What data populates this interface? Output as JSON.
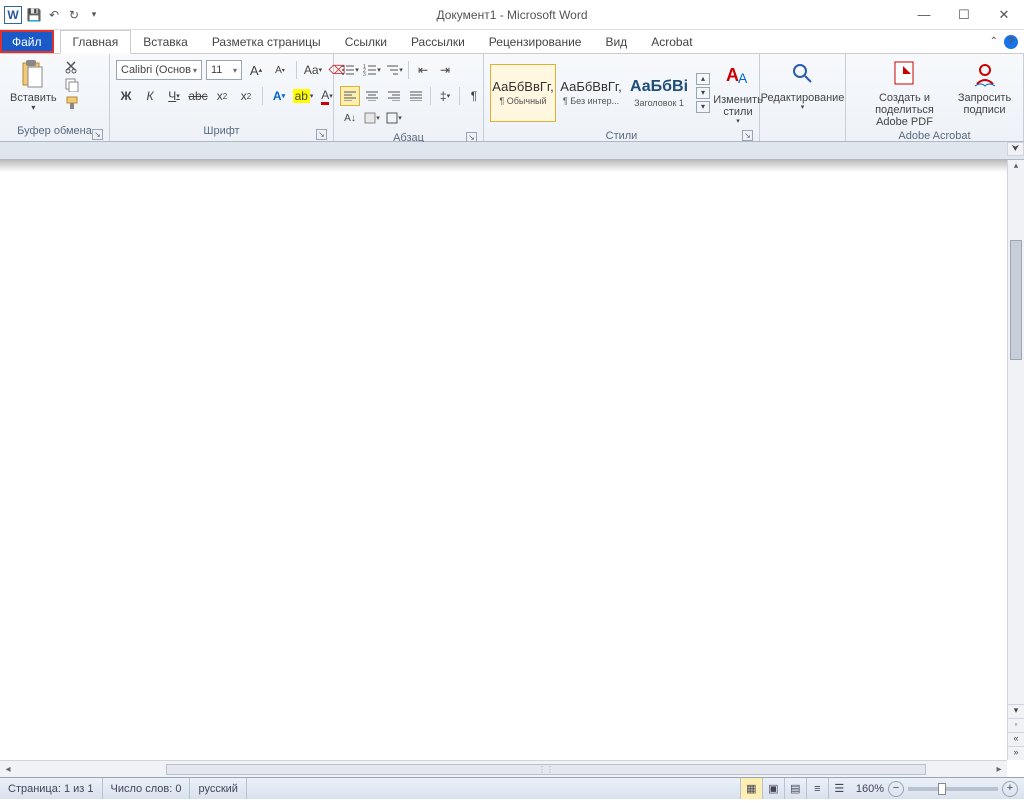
{
  "title": "Документ1 - Microsoft Word",
  "qat": {
    "logo": "W"
  },
  "tabs": {
    "file": "Файл",
    "items": [
      "Главная",
      "Вставка",
      "Разметка страницы",
      "Ссылки",
      "Рассылки",
      "Рецензирование",
      "Вид",
      "Acrobat"
    ],
    "active": 0
  },
  "clipboard": {
    "paste": "Вставить",
    "label": "Буфер обмена"
  },
  "font": {
    "name": "Calibri (Основ",
    "size": "11",
    "label": "Шрифт"
  },
  "paragraph": {
    "label": "Абзац"
  },
  "styles": {
    "label": "Стили",
    "items": [
      {
        "preview": "АаБбВвГг,",
        "name": "¶ Обычный",
        "sel": true
      },
      {
        "preview": "АаБбВвГг,",
        "name": "¶ Без интер...",
        "sel": false
      },
      {
        "preview": "АаБбВі",
        "name": "Заголовок 1",
        "sel": false,
        "big": true
      }
    ],
    "change": "Изменить стили"
  },
  "editing": {
    "label": "Редактирование"
  },
  "acrobat": {
    "create": "Создать и поделиться Adobe PDF",
    "sign": "Запросить подписи",
    "label": "Adobe Acrobat"
  },
  "status": {
    "page": "Страница: 1 из 1",
    "words": "Число слов: 0",
    "lang": "русский",
    "zoom": "160%"
  }
}
